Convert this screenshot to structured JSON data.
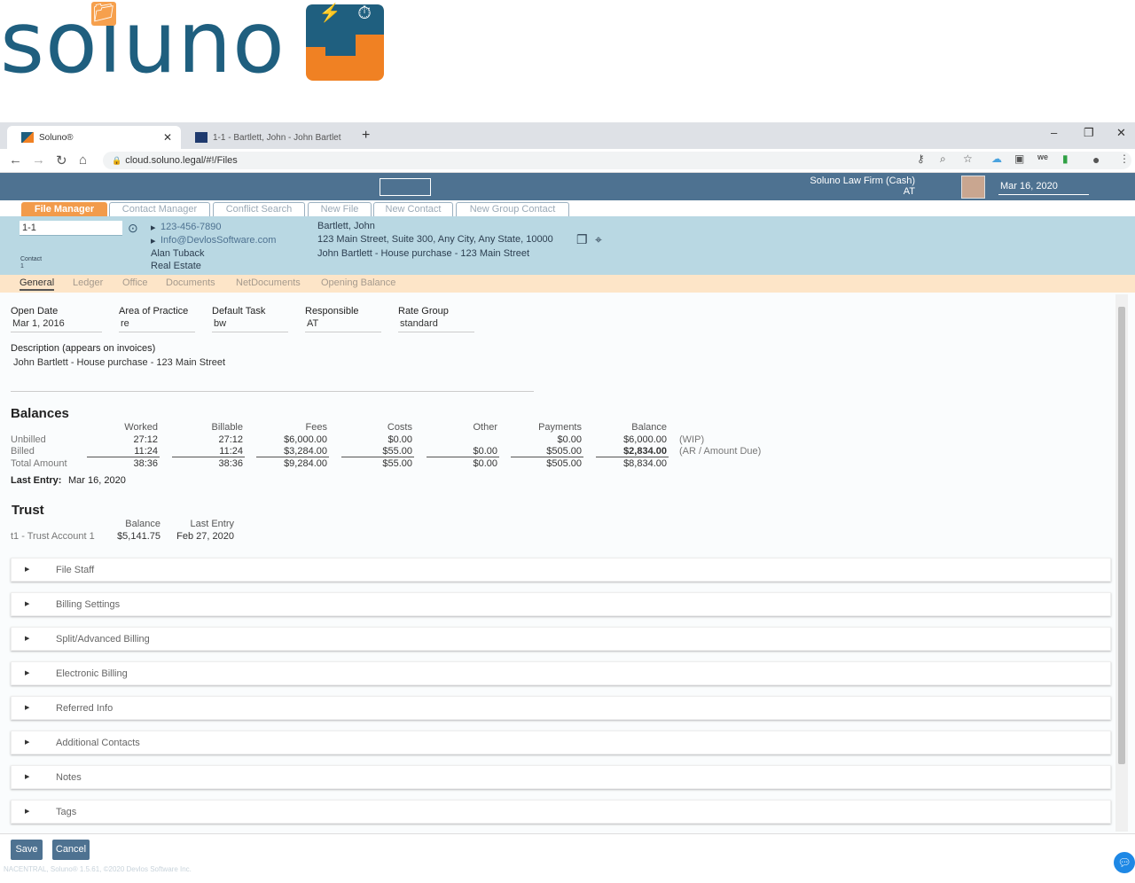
{
  "brand": {
    "logo_text": "soluno",
    "colors": {
      "navy": "#1f5f7f",
      "orange": "#f08123",
      "toolbar": "#4e7291",
      "active_tab": "#f29b4b"
    }
  },
  "browser": {
    "tabs": [
      {
        "title": "Soluno®",
        "active": true
      },
      {
        "title": "1-1 - Bartlett, John - John Bartlet",
        "active": false
      }
    ],
    "new_tab": "+",
    "url": "cloud.soluno.legal/#!/Files"
  },
  "toolbar": {
    "firm_name": "Soluno Law Firm (Cash)",
    "firm_user": "AT",
    "date": "Mar 16, 2020"
  },
  "app_tabs": [
    {
      "label": "File Manager",
      "active": true
    },
    {
      "label": "Contact Manager"
    },
    {
      "label": "Conflict Search"
    },
    {
      "label": "New File"
    },
    {
      "label": "New Contact"
    },
    {
      "label": "New Group Contact"
    }
  ],
  "file_header": {
    "file_no": "1-1",
    "contact_label": "Contact",
    "contact_index": "1",
    "phone": "123-456-7890",
    "email": "Info@DevlosSoftware.com",
    "lawyer": "Alan Tuback",
    "practice": "Real Estate",
    "client_name": "Bartlett, John",
    "address": "123 Main Street, Suite 300, Any City, Any State, 10000",
    "matter": "John Bartlett - House purchase - 123 Main Street"
  },
  "sub_tabs": [
    "General",
    "Ledger",
    "Office",
    "Documents",
    "NetDocuments",
    "Opening Balance"
  ],
  "general": {
    "fields": [
      {
        "label": "Open Date",
        "value": "Mar 1, 2016"
      },
      {
        "label": "Area of Practice",
        "value": "re"
      },
      {
        "label": "Default Task",
        "value": "bw"
      },
      {
        "label": "Responsible",
        "value": "AT"
      },
      {
        "label": "Rate Group",
        "value": "standard"
      }
    ],
    "description_label": "Description (appears on invoices)",
    "description": "John Bartlett - House purchase - 123 Main Street"
  },
  "balances": {
    "title": "Balances",
    "columns": [
      "Worked",
      "Billable",
      "Fees",
      "Costs",
      "Other",
      "Payments",
      "Balance"
    ],
    "rows": [
      {
        "label": "Unbilled",
        "values": [
          "27:12",
          "27:12",
          "$6,000.00",
          "$0.00",
          "",
          "$0.00",
          "$6,000.00"
        ],
        "note": "(WIP)"
      },
      {
        "label": "Billed",
        "values": [
          "11:24",
          "11:24",
          "$3,284.00",
          "$55.00",
          "$0.00",
          "$505.00",
          "$2,834.00"
        ],
        "note": "(AR / Amount Due)"
      },
      {
        "label": "Total Amount",
        "values": [
          "38:36",
          "38:36",
          "$9,284.00",
          "$55.00",
          "$0.00",
          "$505.00",
          "$8,834.00"
        ],
        "note": ""
      }
    ],
    "last_entry_label": "Last Entry:",
    "last_entry": "Mar 16, 2020"
  },
  "trust": {
    "title": "Trust",
    "col_balance": "Balance",
    "col_last": "Last Entry",
    "account": "t1 - Trust Account 1",
    "balance": "$5,141.75",
    "last": "Feb 27, 2020"
  },
  "panels": [
    "File Staff",
    "Billing Settings",
    "Split/Advanced Billing",
    "Electronic Billing",
    "Referred Info",
    "Additional Contacts",
    "Notes",
    "Tags"
  ],
  "footer": {
    "save": "Save",
    "cancel": "Cancel",
    "copyright": "NACENTRAL, Soluno® 1.5.61, ©2020 Devlos Software Inc."
  }
}
